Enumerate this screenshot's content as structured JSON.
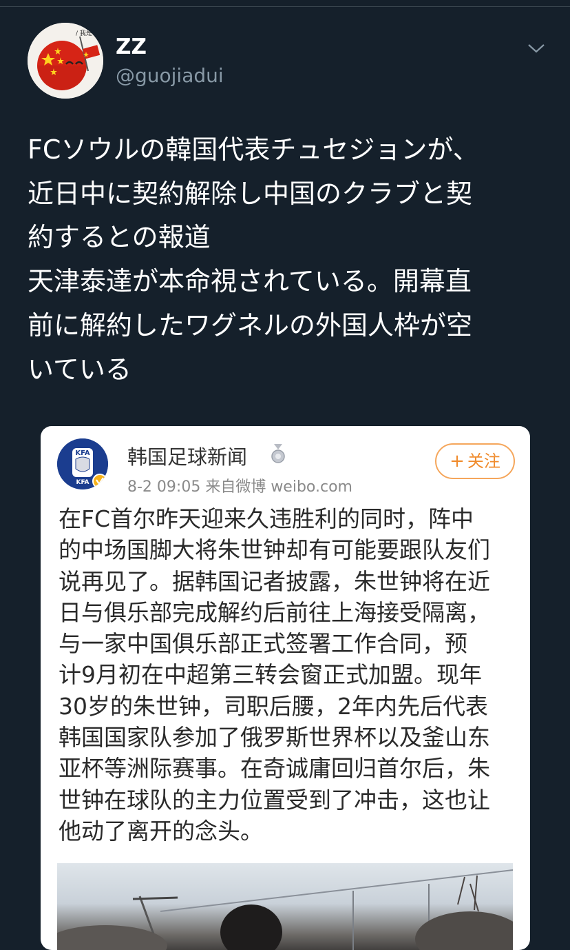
{
  "tweet": {
    "display_name": "ZZ",
    "handle": "@guojiadui",
    "menu_icon": "chevron-down-icon",
    "text": "FCソウルの韓国代表チュセジョンが、\n近日中に契約解除し中国のクラブと契\n約するとの報道\n天津泰達が本命視されている。開幕直\n前に解約したワグネルの外国人枠が空\nいている"
  },
  "embedded_post": {
    "account_name": "韩国足球新闻",
    "badge_icon": "medal-icon",
    "avatar_text_top": "KFA",
    "avatar_text_bottom": "KFA",
    "verified_icon": "verified-v-icon",
    "meta": "8-2 09:05  来自微博 weibo.com",
    "follow_label": "关注",
    "follow_plus": "+",
    "body": "在FC首尔昨天迎来久违胜利的同时，阵中\n的中场国脚大将朱世钟却有可能要跟队友们\n说再见了。据韩国记者披露，朱世钟将在近\n日与俱乐部完成解约后前往上海接受隔离，\n与一家中国俱乐部正式签署工作合同，预\n计9月初在中超第三转会窗正式加盟。现年\n30岁的朱世钟，司职后腰，2年内先后代表\n韩国国家队参加了俄罗斯世界杯以及釜山东\n亚杯等洲际赛事。在奇诚庸回归首尔后，朱\n世钟在球队的主力位置受到了冲击，这也让\n他动了离开的念头。"
  },
  "colors": {
    "background": "#15202b",
    "secondary_text": "#8899a6",
    "follow_accent": "#f08b2c"
  }
}
